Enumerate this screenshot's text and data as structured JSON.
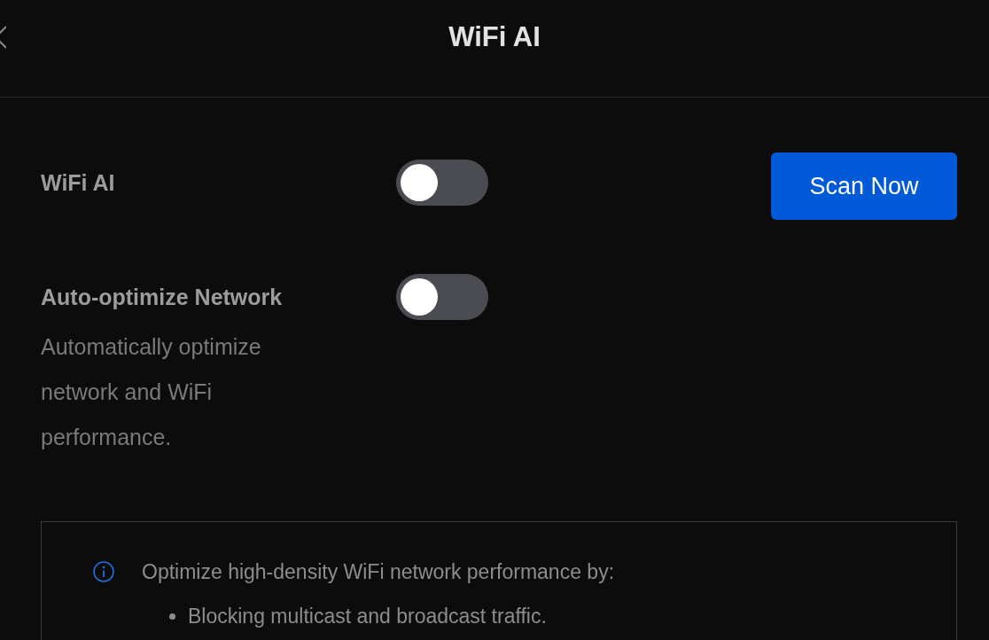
{
  "header": {
    "title": "WiFi AI"
  },
  "settings": [
    {
      "label": "WiFi AI",
      "on": false
    },
    {
      "label": "Auto-optimize Network",
      "on": false,
      "description": "Automatically optimize network and WiFi performance."
    }
  ],
  "scan_button": {
    "label": "Scan Now"
  },
  "info_box": {
    "text": "Optimize high-density WiFi network performance by:",
    "bullets": [
      "Blocking multicast and broadcast traffic."
    ]
  }
}
